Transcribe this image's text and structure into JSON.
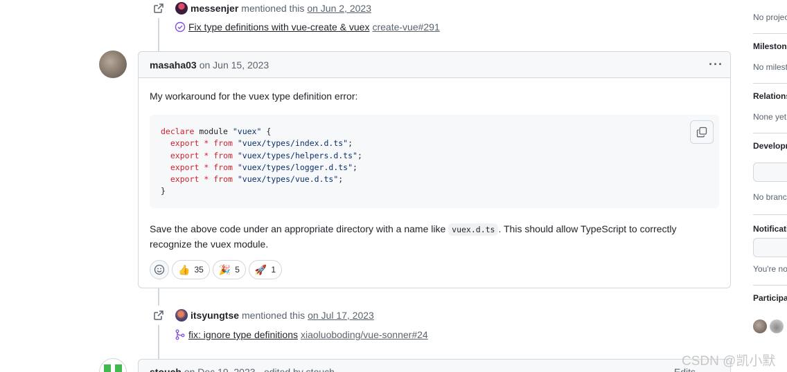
{
  "events": [
    {
      "user": "messenjer",
      "action": "mentioned this",
      "date": "on Jun 2, 2023",
      "ref_title": "Fix type definitions with vue-create & vuex",
      "ref_repo": "create-vue#291"
    },
    {
      "user": "itsyungtse",
      "action": "mentioned this",
      "date": "on Jul 17, 2023",
      "ref_title": "fix: ignore type definitions",
      "ref_repo": "xiaoluoboding/vue-sonner#24"
    }
  ],
  "comment": {
    "author": "masaha03",
    "date": "on Jun 15, 2023",
    "intro": "My workaround for the vuex type definition error:",
    "code": {
      "line1_kw": "declare",
      "line1_mid": " module ",
      "line1_str": "\"vuex\"",
      "line1_end": " {",
      "exports": [
        "\"vuex/types/index.d.ts\"",
        "\"vuex/types/helpers.d.ts\"",
        "\"vuex/types/logger.d.ts\"",
        "\"vuex/types/vue.d.ts\""
      ],
      "export_kw": "export",
      "star": "*",
      "from_kw": "from",
      "semicolon": ";",
      "close": "}"
    },
    "outro_before": "Save the above code under an appropriate directory with a name like ",
    "outro_code": "vuex.d.ts",
    "outro_after": ". This should allow TypeScript to correctly recognize the vuex module.",
    "reactions": [
      {
        "emoji": "👍",
        "count": "35"
      },
      {
        "emoji": "🎉",
        "count": "5"
      },
      {
        "emoji": "🚀",
        "count": "1"
      }
    ]
  },
  "next_comment": {
    "author": "stouch",
    "date": "on Dec 19, 2023",
    "edited": "· edited by stouch",
    "edits_label": "Edits"
  },
  "sidebar": {
    "projects_text": "No projec",
    "milestone_title": "Milestone",
    "milestone_text": "No milest",
    "relations_title": "Relations",
    "relations_text": "None yet",
    "development_title": "Developm",
    "development_text": "No branc",
    "notifications_title": "Notificati",
    "notifications_text": "You're no",
    "participants_title": "Participan"
  },
  "watermark": "CSDN @凯小默"
}
